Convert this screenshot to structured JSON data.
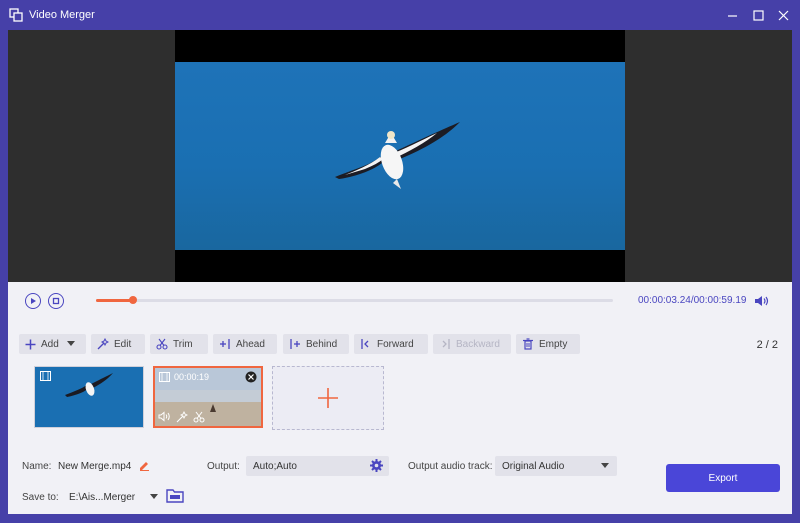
{
  "window": {
    "title": "Video Merger",
    "icons": [
      "app-icon",
      "minimize-icon",
      "maximize-icon",
      "close-icon"
    ]
  },
  "player": {
    "current_time": "00:00:03.24",
    "separator": "/",
    "total_time": "00:00:59.19",
    "progress": 0.072
  },
  "toolbar": {
    "add": "Add",
    "edit": "Edit",
    "trim": "Trim",
    "ahead": "Ahead",
    "behind": "Behind",
    "forward": "Forward",
    "backward": "Backward",
    "empty": "Empty",
    "page_current": "2",
    "page_sep": "/",
    "page_total": "2"
  },
  "clips": [
    {
      "type": "video",
      "selected": false
    },
    {
      "type": "video",
      "selected": true,
      "duration": "00:00:19"
    }
  ],
  "output": {
    "name_label": "Name:",
    "name_value": "New Merge.mp4",
    "output_label": "Output:",
    "output_value": "Auto;Auto",
    "audio_track_label": "Output audio track:",
    "audio_track_value": "Original Audio",
    "save_to_label": "Save to:",
    "save_to_value": "E:\\Ais...Merger",
    "export_label": "Export"
  },
  "colors": {
    "accent": "#4a46c0",
    "titlebar": "#4640a8",
    "highlight": "#f0663f",
    "export": "#4a46d8"
  }
}
